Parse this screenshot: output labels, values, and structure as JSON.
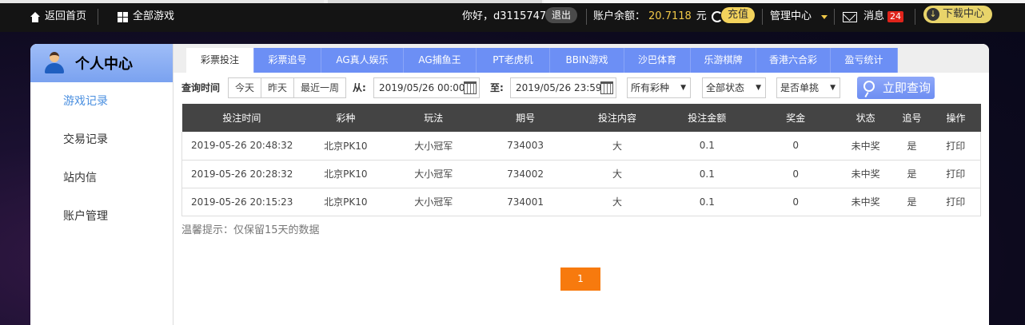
{
  "topbar": {
    "home": "返回首页",
    "all_games": "全部游戏",
    "greeting": "你好，d3115747",
    "logout": "退出",
    "balance_label": "账户余额：",
    "balance_value": "20.7118",
    "balance_unit": "元",
    "recharge": "充值",
    "manage": "管理中心",
    "messages": "消息",
    "message_count": "24",
    "download": "下载中心"
  },
  "sidebar": {
    "title": "个人中心",
    "items": [
      {
        "label": "游戏记录"
      },
      {
        "label": "交易记录"
      },
      {
        "label": "站内信"
      },
      {
        "label": "账户管理"
      }
    ]
  },
  "tabs": [
    {
      "label": "彩票投注"
    },
    {
      "label": "彩票追号"
    },
    {
      "label": "AG真人娱乐"
    },
    {
      "label": "AG捕鱼王"
    },
    {
      "label": "PT老虎机"
    },
    {
      "label": "BBIN游戏"
    },
    {
      "label": "沙巴体育"
    },
    {
      "label": "乐游棋牌"
    },
    {
      "label": "香港六合彩"
    },
    {
      "label": "盈亏统计"
    }
  ],
  "filters": {
    "query_time_label": "查询时间",
    "quick": [
      "今天",
      "昨天",
      "最近一周"
    ],
    "from_label": "从:",
    "from_value": "2019/05/26 00:00",
    "to_label": "至:",
    "to_value": "2019/05/26 23:59",
    "lottery_select": "所有彩种",
    "status_select": "全部状态",
    "single_select": "是否单挑",
    "query_button": "立即查询"
  },
  "table": {
    "headers": [
      "投注时间",
      "彩种",
      "玩法",
      "期号",
      "投注内容",
      "投注金额",
      "奖金",
      "状态",
      "追号",
      "操作"
    ],
    "rows": [
      [
        "2019-05-26 20:48:32",
        "北京PK10",
        "大小冠军",
        "734003",
        "大",
        "0.1",
        "0",
        "未中奖",
        "是",
        "打印"
      ],
      [
        "2019-05-26 20:28:32",
        "北京PK10",
        "大小冠军",
        "734002",
        "大",
        "0.1",
        "0",
        "未中奖",
        "是",
        "打印"
      ],
      [
        "2019-05-26 20:15:23",
        "北京PK10",
        "大小冠军",
        "734001",
        "大",
        "0.1",
        "0",
        "未中奖",
        "是",
        "打印"
      ]
    ]
  },
  "tip": "温馨提示：仅保留15天的数据",
  "pagination": {
    "current": "1"
  }
}
